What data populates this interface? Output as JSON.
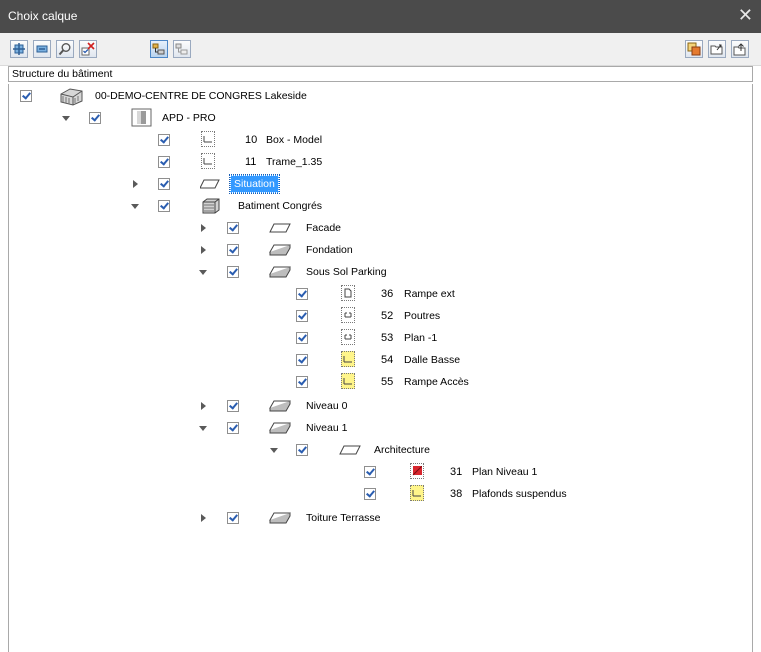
{
  "window": {
    "title": "Choix calque",
    "close": "✕"
  },
  "toolbar": {
    "left_buttons": [
      "expand-all-icon",
      "collapse-all-icon",
      "search-icon",
      "toggle-checks-icon",
      "structure-view-icon",
      "layer-view-icon"
    ],
    "right_buttons": [
      "copy-icon",
      "open-icon",
      "export-icon"
    ]
  },
  "header": {
    "column": "Structure du bâtiment"
  },
  "tree": {
    "root": {
      "label": "00-DEMO-CENTRE DE CONGRES Lakeside"
    },
    "apd": {
      "label": "APD - PRO"
    },
    "box_model": {
      "num": "10",
      "label": "Box - Model"
    },
    "trame": {
      "num": "11",
      "label": "Trame_1.35"
    },
    "situation": {
      "label": "Situation"
    },
    "batiment": {
      "label": "Batiment Congrés"
    },
    "facade": {
      "label": "Facade"
    },
    "fondation": {
      "label": "Fondation"
    },
    "sous_sol": {
      "label": "Sous Sol Parking"
    },
    "rampe_ext": {
      "num": "36",
      "label": "Rampe ext"
    },
    "poutres": {
      "num": "52",
      "label": "Poutres"
    },
    "plan_m1": {
      "num": "53",
      "label": "Plan -1"
    },
    "dalle_basse": {
      "num": "54",
      "label": "Dalle Basse"
    },
    "rampe_acces": {
      "num": "55",
      "label": "Rampe Accès"
    },
    "niveau0": {
      "label": "Niveau 0"
    },
    "niveau1": {
      "label": "Niveau 1"
    },
    "architecture": {
      "label": "Architecture"
    },
    "plan_niveau1": {
      "num": "31",
      "label": "Plan Niveau 1"
    },
    "plafonds": {
      "num": "38",
      "label": "Plafonds suspendus"
    },
    "toiture": {
      "label": "Toiture Terrasse"
    }
  },
  "colors": {
    "titlebar": "#4b4b4b",
    "selection": "#3399ff",
    "check": "#2a5db0"
  }
}
